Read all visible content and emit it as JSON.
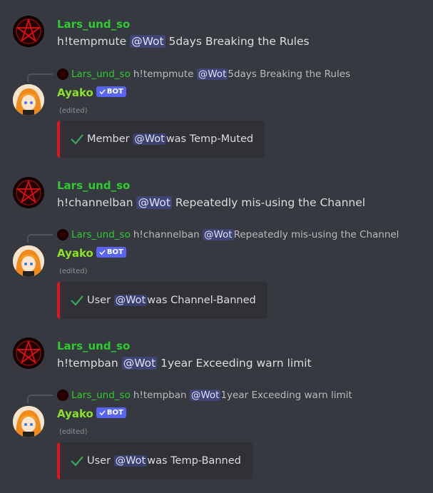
{
  "messages": [
    {
      "author": "Lars_und_so",
      "parts": [
        "h!tempmute ",
        "@Wot",
        " 5days Breaking the Rules"
      ]
    },
    {
      "author": "Ayako",
      "badge": "BOT",
      "reply": {
        "author": "Lars_und_so",
        "parts": [
          "h!tempmute ",
          "@Wot",
          " 5days Breaking the Rules"
        ]
      },
      "edited": "(edited)",
      "embed": [
        "Member ",
        "@Wot",
        " was Temp-Muted"
      ]
    },
    {
      "author": "Lars_und_so",
      "parts": [
        "h!channelban ",
        "@Wot",
        " Repeatedly mis-using the Channel"
      ]
    },
    {
      "author": "Ayako",
      "badge": "BOT",
      "reply": {
        "author": "Lars_und_so",
        "parts": [
          "h!channelban ",
          "@Wot",
          " Repeatedly mis-using the Channel"
        ]
      },
      "edited": "(edited)",
      "embed": [
        "User ",
        "@Wot",
        " was Channel-Banned"
      ]
    },
    {
      "author": "Lars_und_so",
      "parts": [
        "h!tempban ",
        "@Wot",
        " 1year Exceeding warn limit"
      ]
    },
    {
      "author": "Ayako",
      "badge": "BOT",
      "reply": {
        "author": "Lars_und_so",
        "parts": [
          "h!tempban ",
          "@Wot",
          " 1year Exceeding warn limit"
        ]
      },
      "edited": "(edited)",
      "embed": [
        "User ",
        "@Wot",
        " was Temp-Banned"
      ]
    }
  ],
  "colors": {
    "background": "#36393f",
    "lars_name": "#2ecc2e",
    "ayako_name": "#8ee02a",
    "bot_badge": "#5865f2",
    "embed_bar": "#e0161b",
    "embed_bg": "#2f3136",
    "check": "#3ba55c"
  },
  "icons": {
    "lars_avatar": "pentagram-avatar",
    "ayako_avatar": "anime-girl-avatar",
    "bot_verified": "checkmark-icon",
    "embed_success": "checkmark-icon"
  }
}
